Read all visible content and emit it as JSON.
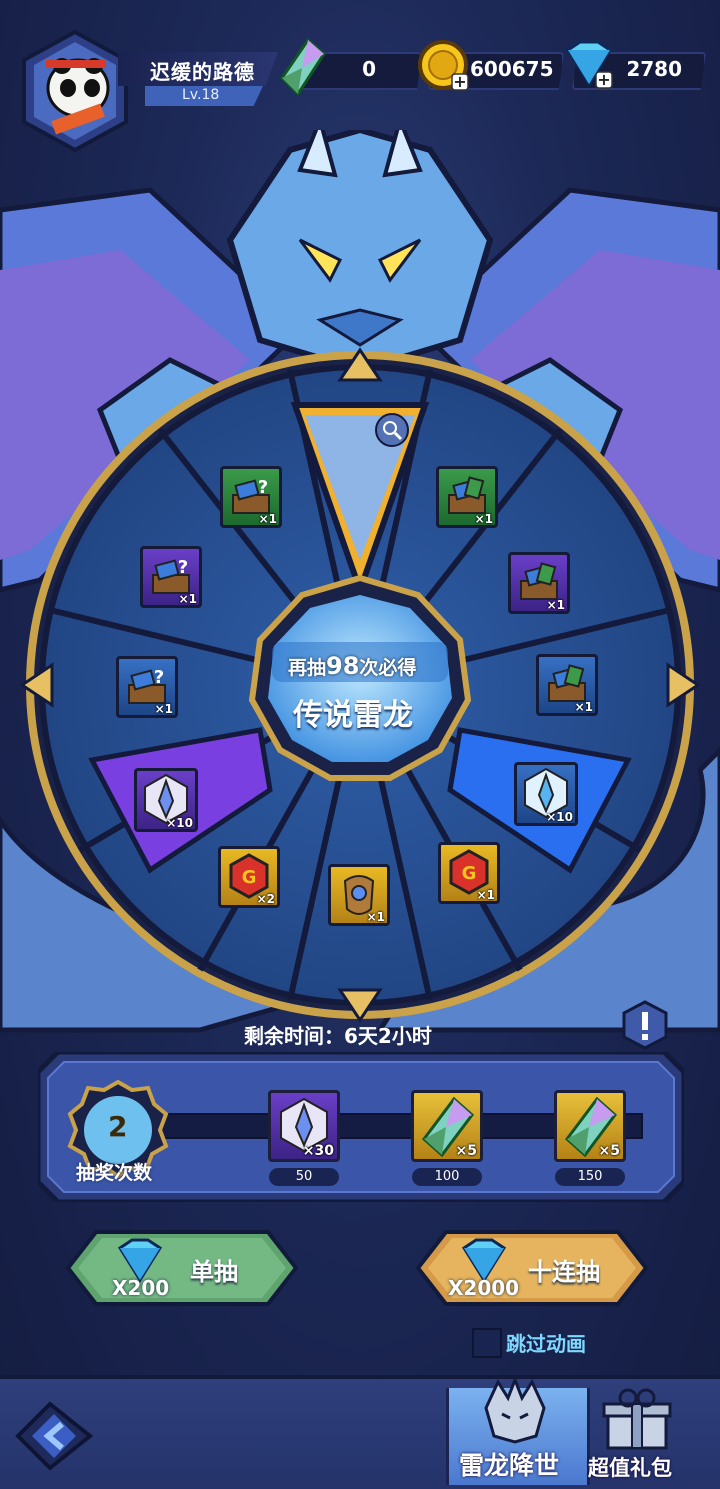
{
  "player": {
    "name": "迟缓的路德",
    "level": "Lv.18"
  },
  "currencies": [
    {
      "icon": "crystal-shard-icon",
      "value": "0"
    },
    {
      "icon": "gold-coin-icon",
      "value": "600675"
    },
    {
      "icon": "diamond-icon",
      "value": "2780"
    }
  ],
  "wheel": {
    "center_line1_prefix": "再抽",
    "center_line1_number": "98",
    "center_line1_suffix": "次必得",
    "center_line2": "传说雷龙",
    "items": [
      {
        "icon": "mystery-chest-icon",
        "qty": "×1",
        "color": "green"
      },
      {
        "icon": "mystery-chest-icon",
        "qty": "×1",
        "color": "green"
      },
      {
        "icon": "mystery-chest-icon",
        "qty": "×1",
        "color": "purple"
      },
      {
        "icon": "mystery-chest-icon",
        "qty": "×1",
        "color": "purple"
      },
      {
        "icon": "mystery-chest-icon",
        "qty": "×1",
        "color": "blue"
      },
      {
        "icon": "mystery-chest-icon",
        "qty": "×1",
        "color": "blue"
      },
      {
        "icon": "crystal-badge-icon",
        "qty": "×10",
        "color": "purple"
      },
      {
        "icon": "crystal-badge-icon",
        "qty": "×10",
        "color": "blue"
      },
      {
        "icon": "red-gem-icon",
        "qty": "×2",
        "color": "gold"
      },
      {
        "icon": "red-gem-icon",
        "qty": "×1",
        "color": "gold"
      },
      {
        "icon": "amulet-icon",
        "qty": "×1",
        "color": "gold"
      }
    ]
  },
  "timer": "剩余时间：6天2小时",
  "progress": {
    "draw_count": "2",
    "draw_label": "抽奖次数",
    "rewards": [
      {
        "icon": "crystal-badge-icon",
        "qty": "×30",
        "milestone": "50"
      },
      {
        "icon": "crystal-shard-icon",
        "qty": "×5",
        "milestone": "100"
      },
      {
        "icon": "crystal-shard-icon",
        "qty": "×5",
        "milestone": "150"
      }
    ]
  },
  "buttons": {
    "single_label": "单抽",
    "single_cost": "X200",
    "ten_label": "十连抽",
    "ten_cost": "X2000",
    "skip_label": "跳过动画"
  },
  "nav": {
    "tab1_label": "雷龙降世",
    "tab2_label": "超值礼包"
  }
}
